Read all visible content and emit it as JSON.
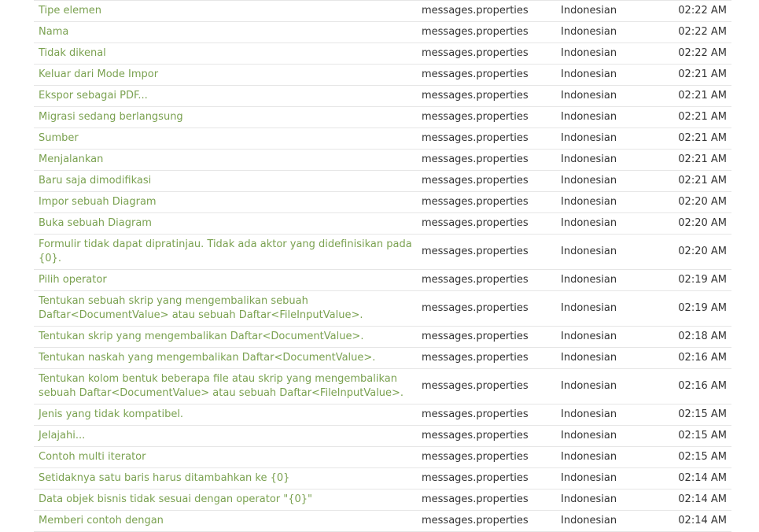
{
  "columns": [
    "title",
    "file",
    "language",
    "time"
  ],
  "rows": [
    {
      "title": "Tipe elemen",
      "file": "messages.properties",
      "language": "Indonesian",
      "time": "02:22 AM"
    },
    {
      "title": "Nama",
      "file": "messages.properties",
      "language": "Indonesian",
      "time": "02:22 AM"
    },
    {
      "title": "Tidak dikenal",
      "file": "messages.properties",
      "language": "Indonesian",
      "time": "02:22 AM"
    },
    {
      "title": "Keluar dari Mode Impor",
      "file": "messages.properties",
      "language": "Indonesian",
      "time": "02:21 AM"
    },
    {
      "title": "Ekspor sebagai PDF...",
      "file": "messages.properties",
      "language": "Indonesian",
      "time": "02:21 AM"
    },
    {
      "title": "Migrasi sedang berlangsung",
      "file": "messages.properties",
      "language": "Indonesian",
      "time": "02:21 AM"
    },
    {
      "title": "Sumber",
      "file": "messages.properties",
      "language": "Indonesian",
      "time": "02:21 AM"
    },
    {
      "title": "Menjalankan",
      "file": "messages.properties",
      "language": "Indonesian",
      "time": "02:21 AM"
    },
    {
      "title": "Baru saja dimodifikasi",
      "file": "messages.properties",
      "language": "Indonesian",
      "time": "02:21 AM"
    },
    {
      "title": "Impor sebuah Diagram",
      "file": "messages.properties",
      "language": "Indonesian",
      "time": "02:20 AM"
    },
    {
      "title": "Buka sebuah Diagram",
      "file": "messages.properties",
      "language": "Indonesian",
      "time": "02:20 AM"
    },
    {
      "title": "Formulir tidak dapat dipratinjau. Tidak ada aktor yang didefinisikan pada {0}.",
      "file": "messages.properties",
      "language": "Indonesian",
      "time": "02:20 AM"
    },
    {
      "title": "Pilih operator",
      "file": "messages.properties",
      "language": "Indonesian",
      "time": "02:19 AM"
    },
    {
      "title": "Tentukan sebuah skrip yang mengembalikan sebuah Daftar<DocumentValue> atau sebuah Daftar<FileInputValue>.",
      "file": "messages.properties",
      "language": "Indonesian",
      "time": "02:19 AM",
      "tall": true
    },
    {
      "title": "Tentukan skrip yang mengembalikan Daftar<DocumentValue>.",
      "file": "messages.properties",
      "language": "Indonesian",
      "time": "02:18 AM"
    },
    {
      "title": "Tentukan naskah yang mengembalikan Daftar<DocumentValue>.",
      "file": "messages.properties",
      "language": "Indonesian",
      "time": "02:16 AM"
    },
    {
      "title": "Tentukan kolom bentuk beberapa file atau skrip yang mengembalikan sebuah Daftar<DocumentValue> atau sebuah Daftar<FileInputValue>.",
      "file": "messages.properties",
      "language": "Indonesian",
      "time": "02:16 AM",
      "tall": true
    },
    {
      "title": "Jenis yang tidak kompatibel.",
      "file": "messages.properties",
      "language": "Indonesian",
      "time": "02:15 AM"
    },
    {
      "title": "Jelajahi...",
      "file": "messages.properties",
      "language": "Indonesian",
      "time": "02:15 AM"
    },
    {
      "title": "Contoh multi iterator",
      "file": "messages.properties",
      "language": "Indonesian",
      "time": "02:15 AM"
    },
    {
      "title": "Setidaknya satu baris harus ditambahkan ke {0}",
      "file": "messages.properties",
      "language": "Indonesian",
      "time": "02:14 AM"
    },
    {
      "title": "Data objek bisnis tidak sesuai dengan operator \"{0}\"",
      "file": "messages.properties",
      "language": "Indonesian",
      "time": "02:14 AM"
    },
    {
      "title": "Memberi contoh dengan",
      "file": "messages.properties",
      "language": "Indonesian",
      "time": "02:14 AM"
    }
  ],
  "colors": {
    "title_link": "#7aa150",
    "text": "#333333",
    "row_border": "#e6e6e6"
  }
}
